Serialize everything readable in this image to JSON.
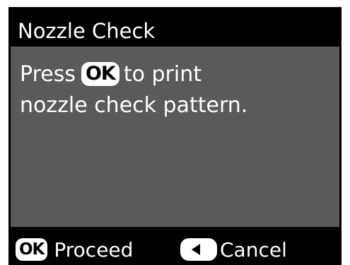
{
  "header": {
    "title": "Nozzle Check"
  },
  "content": {
    "line1_before": "Press",
    "ok_key": "OK",
    "line1_after": "to print",
    "line2": "nozzle check pattern."
  },
  "footer": {
    "ok_key": "OK",
    "ok_label": "Proceed",
    "back_icon": "left-triangle-icon",
    "cancel_label": "Cancel"
  },
  "colors": {
    "frame": "#000000",
    "content_background": "#5a5a5a",
    "text": "#ffffff"
  }
}
